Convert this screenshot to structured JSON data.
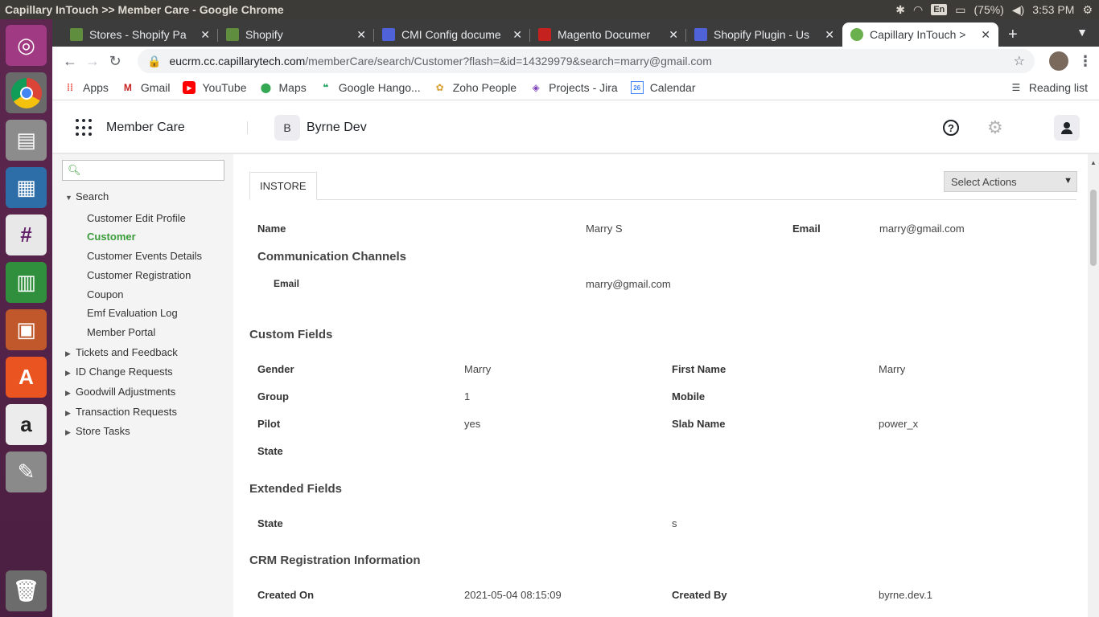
{
  "os": {
    "window_title": "Capillary InTouch >> Member Care - Google Chrome",
    "battery": "(75%)",
    "time": "3:53 PM",
    "keyboard_lang": "En"
  },
  "tabs": [
    {
      "label": "Stores - Shopify Pa",
      "color": "#5e8e3e"
    },
    {
      "label": "Shopify",
      "color": "#5e8e3e"
    },
    {
      "label": "CMI Config docume",
      "color": "#4f62d8"
    },
    {
      "label": "Magento Documer",
      "color": "#c5221f"
    },
    {
      "label": "Shopify Plugin - Us",
      "color": "#4f62d8"
    },
    {
      "label": "Capillary InTouch >",
      "color": "#6ab04c",
      "active": true
    }
  ],
  "address": {
    "host": "eucrm.cc.capillarytech.com",
    "path": "/memberCare/search/Customer?flash=&id=14329979&search=marry@gmail.com"
  },
  "bookmarks": [
    "Apps",
    "Gmail",
    "YouTube",
    "Maps",
    "Google Hango...",
    "Zoho People",
    "Projects - Jira",
    "Calendar"
  ],
  "reading_list": "Reading list",
  "app": {
    "name": "Member Care",
    "org_initial": "B",
    "org_name": "Byrne Dev"
  },
  "sidebar": {
    "search_placeholder": "",
    "search_group": "Search",
    "search_items": [
      "Customer Edit Profile",
      "Customer",
      "Customer Events Details",
      "Customer Registration",
      "Coupon",
      "Emf Evaluation Log",
      "Member Portal"
    ],
    "groups": [
      "Tickets and Feedback",
      "ID Change Requests",
      "Goodwill Adjustments",
      "Transaction Requests",
      "Store Tasks"
    ]
  },
  "main": {
    "tab": "INSTORE",
    "select_actions": "Select Actions",
    "name_label": "Name",
    "name_value": "Marry S",
    "email_label": "Email",
    "email_value": "marry@gmail.com",
    "comm_heading": "Communication Channels",
    "comm_email_label": "Email",
    "comm_email_value": "marry@gmail.com",
    "custom_heading": "Custom Fields",
    "custom_fields": {
      "gender_label": "Gender",
      "gender_value": "Marry",
      "first_name_label": "First Name",
      "first_name_value": "Marry",
      "group_label": "Group",
      "group_value": "1",
      "mobile_label": "Mobile",
      "pilot_label": "Pilot",
      "pilot_value": "yes",
      "slab_label": "Slab Name",
      "slab_value": "power_x",
      "state_label": "State"
    },
    "extended_heading": "Extended Fields",
    "extended_state_label": "State",
    "extended_state_value": "s",
    "crm_heading": "CRM Registration Information",
    "created_on_label": "Created On",
    "created_on_value": "2021-05-04 08:15:09",
    "created_by_label": "Created By",
    "created_by_value": "byrne.dev.1"
  }
}
